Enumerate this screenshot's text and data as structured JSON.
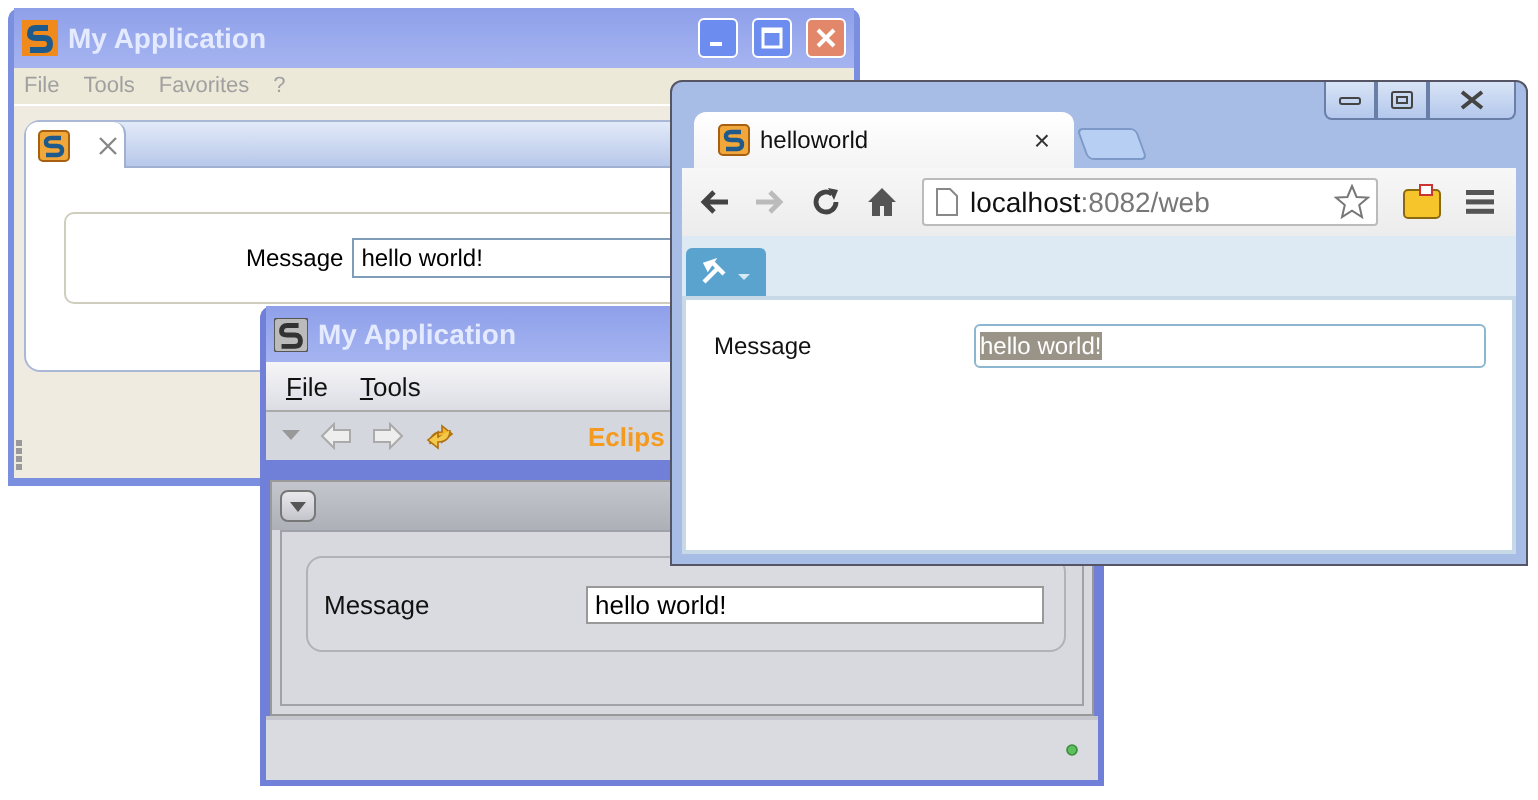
{
  "back_window": {
    "title": "My Application",
    "menu": [
      "File",
      "Tools",
      "Favorites",
      "?"
    ],
    "form": {
      "label": "Message",
      "value": "hello world!"
    }
  },
  "eclipse_window": {
    "title": "My Application",
    "menu": [
      "File",
      "Tools"
    ],
    "brand": "Eclips",
    "form": {
      "label": "Message",
      "value": "hello world!"
    }
  },
  "browser": {
    "tab": {
      "title": "helloworld",
      "close": "×",
      "selected": true
    },
    "forward_disabled": true,
    "address": {
      "host": "localhost",
      "rest": ":8082/web"
    },
    "form": {
      "label": "Message",
      "value": "hello world!",
      "selected": true
    }
  }
}
